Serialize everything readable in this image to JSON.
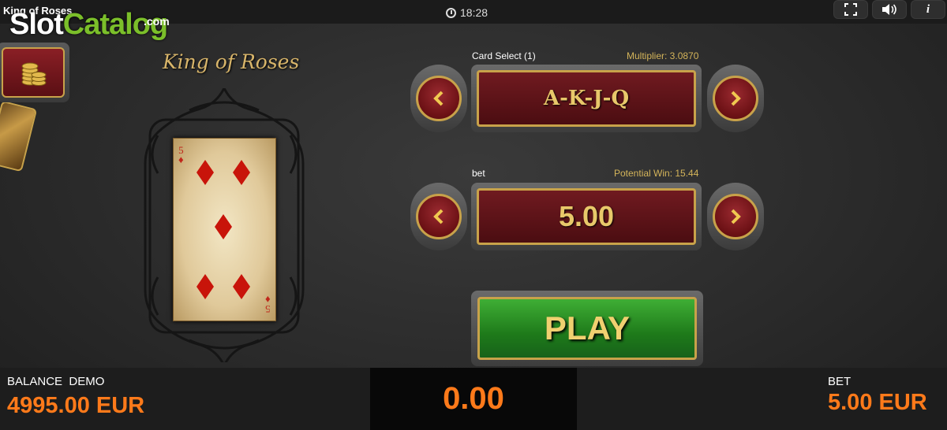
{
  "header": {
    "game_title": "King of Roses",
    "time": "18:28",
    "watermark": {
      "part1": "Slot",
      "part2": "Catalog",
      "suffix": ".com"
    },
    "buttons": {
      "fullscreen_icon": "fullscreen-icon",
      "sound_icon": "speaker-icon",
      "info_label": "i"
    }
  },
  "logo_text": "King of Roses",
  "card": {
    "rank": "5",
    "suit": "diamonds",
    "suit_symbol": "♦",
    "color": "#c0261a"
  },
  "card_select": {
    "label": "Card Select (1)",
    "multiplier": "Multiplier: 3.0870",
    "value": "A-K-J-Q"
  },
  "bet_select": {
    "label": "bet",
    "potential_win": "Potential Win: 15.44",
    "value": "5.00"
  },
  "play_label": "PLAY",
  "footer": {
    "balance_label": "BALANCE  DEMO",
    "balance_value": "4995.00 EUR",
    "win_value": "0.00",
    "bet_label": "BET",
    "bet_value": "5.00 EUR"
  },
  "colors": {
    "accent_gold": "#c8a24a",
    "value_orange": "#ff7a1a",
    "panel_red": "#701a20",
    "play_green": "#2e9428"
  }
}
